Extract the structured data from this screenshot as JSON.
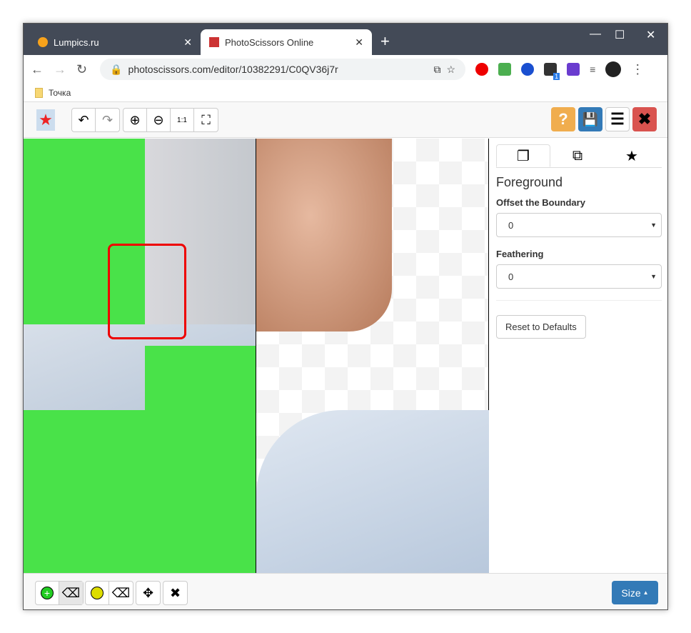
{
  "browser": {
    "tabs": [
      {
        "title": "Lumpics.ru",
        "active": false
      },
      {
        "title": "PhotoScissors Online",
        "active": true
      }
    ],
    "url": "photoscissors.com/editor/10382291/C0QV36j7r",
    "extension_badge": "1",
    "bookmarks": [
      {
        "label": "Точка"
      }
    ]
  },
  "toolbar": {
    "help": "?"
  },
  "panel": {
    "tabs": [
      "foreground-tab",
      "background-tab",
      "effects-tab"
    ],
    "title": "Foreground",
    "offset_label": "Offset the Boundary",
    "offset_value": "0",
    "feather_label": "Feathering",
    "feather_value": "0",
    "reset_label": "Reset to Defaults"
  },
  "bottom": {
    "size_label": "Size"
  },
  "colors": {
    "accent": "#337ab7",
    "help": "#f0ad4e",
    "close": "#d9534f",
    "mask_green": "#49e249"
  }
}
